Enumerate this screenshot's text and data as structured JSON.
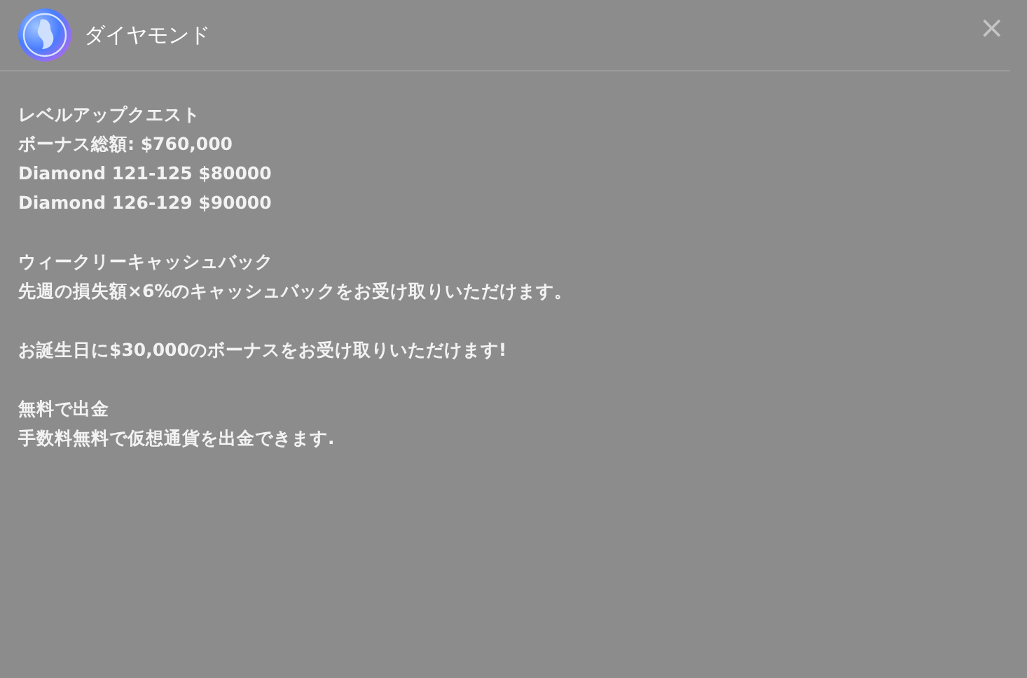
{
  "modal": {
    "title": "ダイヤモンド",
    "close": "×",
    "sections": [
      {
        "lines": [
          "レベルアップクエスト",
          "ボーナス総額: $760,000",
          "Diamond 121-125 $80000",
          "Diamond 126-129 $90000"
        ]
      },
      {
        "lines": [
          "ウィークリーキャッシュバック",
          "先週の損失額×6%のキャッシュバックをお受け取りいただけます。"
        ]
      },
      {
        "lines": [
          "お誕生日に$30,000のボーナスをお受け取りいただけます!"
        ]
      },
      {
        "lines": [
          "無料で出金",
          "手数料無料で仮想通貨を出金できます."
        ]
      }
    ]
  }
}
